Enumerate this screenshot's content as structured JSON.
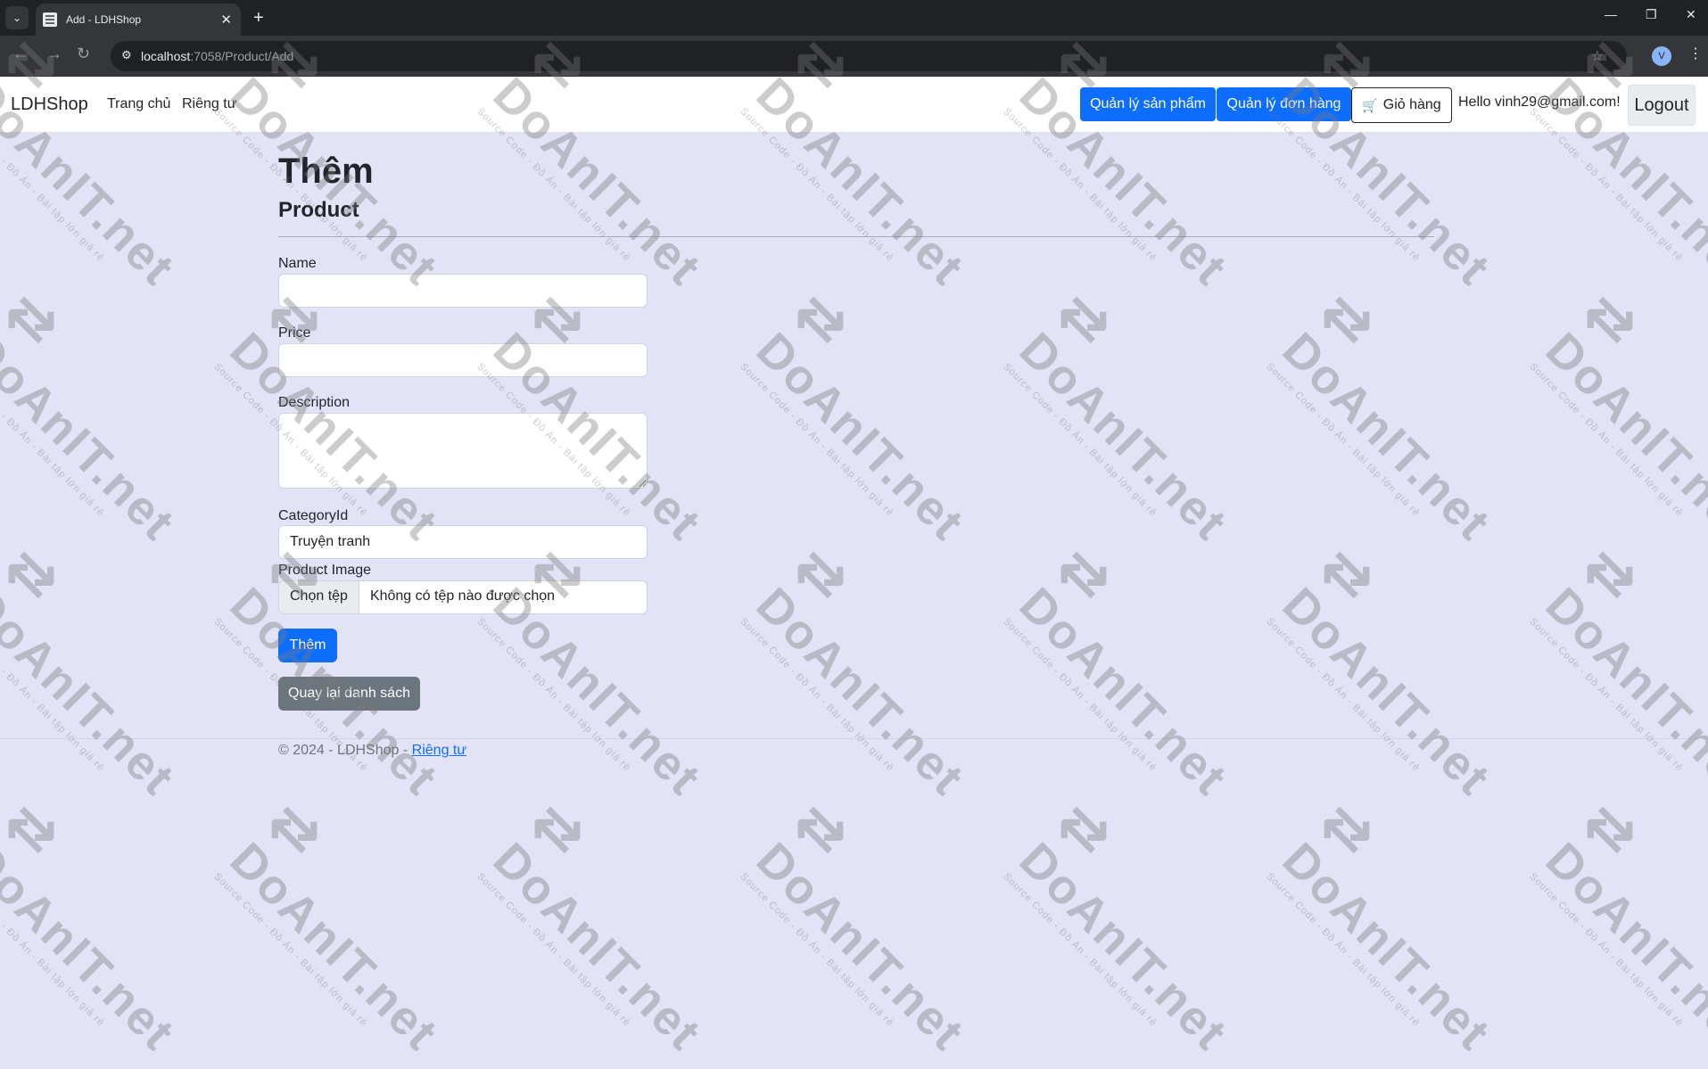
{
  "browser": {
    "tab_title": "Add - LDHShop",
    "url_host": "localhost",
    "url_path": ":7058/Product/Add",
    "profile_initial": "V"
  },
  "navbar": {
    "brand": "LDHShop",
    "links": [
      "Trang chủ",
      "Riêng tư"
    ],
    "manage_products": "Quản lý sản phẩm",
    "manage_orders": "Quản lý đơn hàng",
    "cart": "Giỏ hàng",
    "greeting": "Hello vinh29@gmail.com!",
    "logout": "Logout"
  },
  "form": {
    "title": "Thêm",
    "subtitle": "Product",
    "name_label": "Name",
    "name_value": "",
    "price_label": "Price",
    "price_value": "",
    "description_label": "Description",
    "description_value": "",
    "category_label": "CategoryId",
    "category_selected": "Truyện tranh",
    "image_label": "Product Image",
    "file_button": "Chọn tệp",
    "file_status": "Không có tệp nào được chọn",
    "submit": "Thêm",
    "back": "Quay lại danh sách"
  },
  "footer": {
    "copyright": "© 2024 - LDHShop -",
    "privacy": "Riêng tư"
  },
  "watermark": {
    "text": "DoAnIT.net",
    "subtext": "Source Code - Đồ Án - Bài tập lớn giá rẻ"
  }
}
